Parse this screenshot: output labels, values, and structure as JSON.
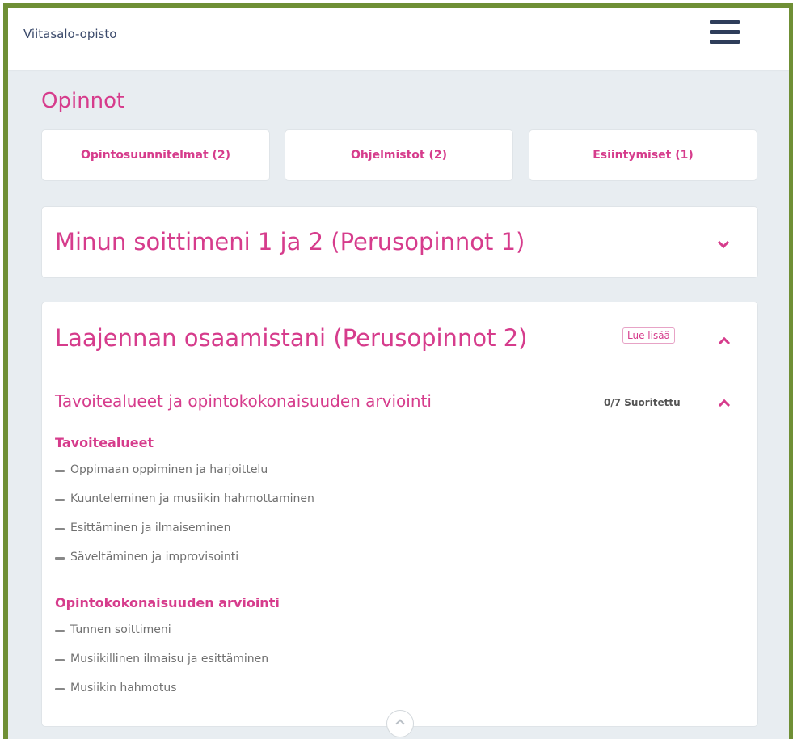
{
  "header": {
    "brand": "Viitasalo-opisto",
    "menu_icon": "hamburger-menu-icon"
  },
  "main": {
    "title": "Opinnot",
    "tabs": [
      {
        "label": "Opintosuunnitelmat (2)"
      },
      {
        "label": "Ohjelmistot (2)"
      },
      {
        "label": "Esiintymiset (1)"
      }
    ],
    "courses": [
      {
        "title": "Minun soittimeni 1 ja 2 (Perusopinnot 1)",
        "expanded": false
      },
      {
        "title": "Laajennan osaamistani (Perusopinnot 2)",
        "read_more_label": "Lue lisää",
        "expanded": true,
        "section": {
          "title": "Tavoitealueet ja opintokokonaisuuden arviointi",
          "status": "0/7 Suoritettu",
          "groups": [
            {
              "heading": "Tavoitealueet",
              "items": [
                "Oppimaan oppiminen ja harjoittelu",
                "Kuunteleminen ja musiikin hahmottaminen",
                "Esittäminen ja ilmaiseminen",
                "Säveltäminen ja improvisointi"
              ]
            },
            {
              "heading": "Opintokokonaisuuden arviointi",
              "items": [
                "Tunnen soittimeni",
                "Musiikillinen ilmaisu ja esittäminen",
                "Musiikin hahmotus"
              ]
            }
          ]
        }
      }
    ]
  },
  "colors": {
    "accent": "#d63c8c",
    "frame_border": "#6f8f35",
    "page_background": "#e8edf1",
    "nav_text": "#3b4a6b",
    "menu_icon": "#2e3d5a"
  }
}
